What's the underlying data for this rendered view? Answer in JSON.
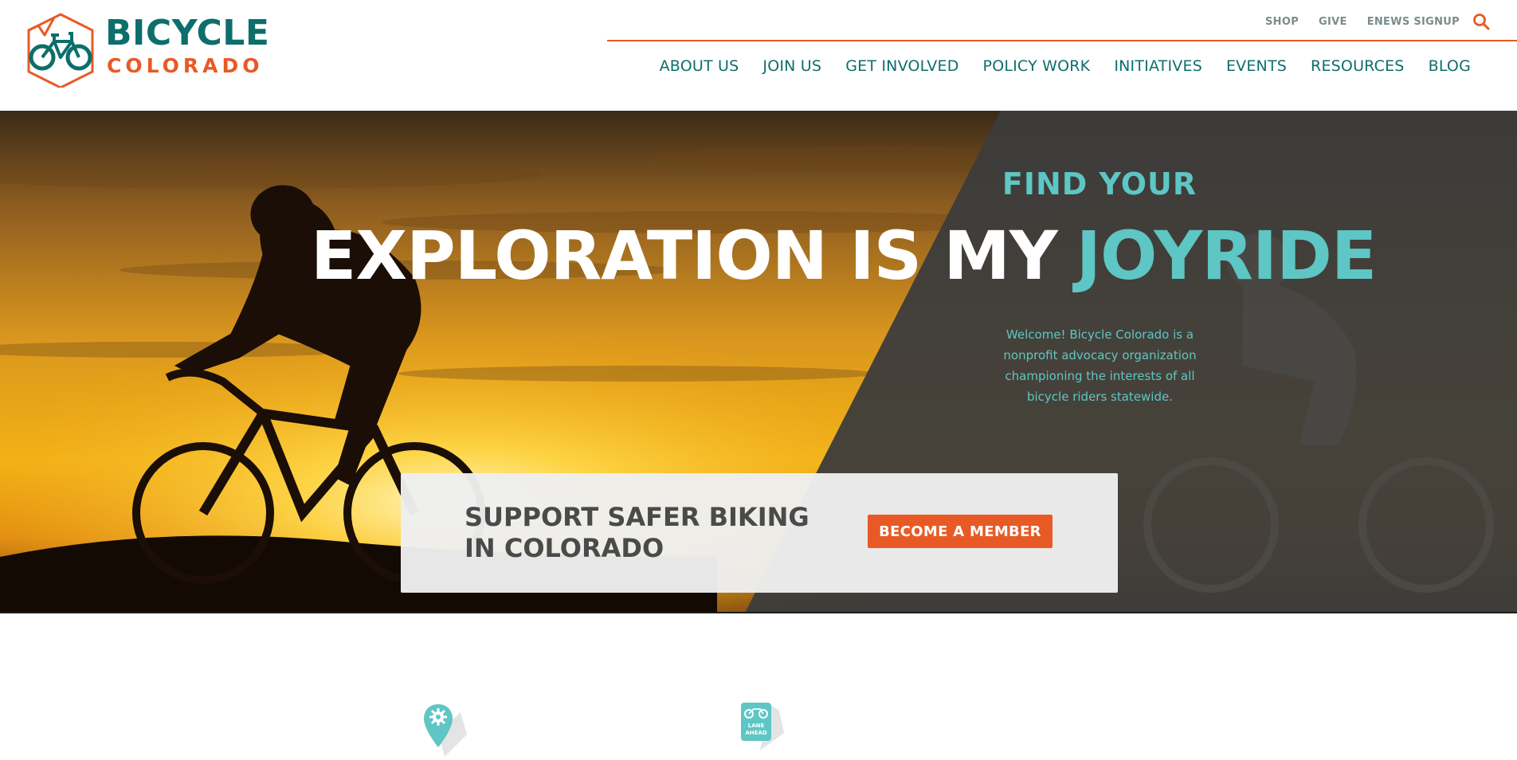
{
  "brand": {
    "name_line1": "BICYCLE",
    "name_line2": "COLORADO",
    "primary_color": "#0d6e6b",
    "accent_color": "#e85a25",
    "teal_color": "#5ec6c4"
  },
  "utility_nav": {
    "items": [
      {
        "label": "SHOP"
      },
      {
        "label": "GIVE"
      },
      {
        "label": "ENEWS SIGNUP"
      }
    ],
    "search_icon": "search-icon"
  },
  "main_nav": {
    "items": [
      {
        "label": "ABOUT US"
      },
      {
        "label": "JOIN US"
      },
      {
        "label": "GET INVOLVED"
      },
      {
        "label": "POLICY WORK"
      },
      {
        "label": "INITIATIVES"
      },
      {
        "label": "EVENTS"
      },
      {
        "label": "RESOURCES"
      },
      {
        "label": "BLOG"
      }
    ]
  },
  "hero": {
    "eyebrow": "FIND YOUR",
    "title_white": "EXPLORATION IS MY",
    "title_teal": "JOYRIDE",
    "welcome": "Welcome! Bicycle Colorado is a nonprofit advocacy organization championing the interests of all bicycle riders statewide."
  },
  "cta": {
    "text": "SUPPORT SAFER BIKING IN COLORADO",
    "button_label": "BECOME A MEMBER"
  },
  "features": {
    "icons": [
      "map-pin-gear-icon",
      "bike-lane-sign-icon"
    ],
    "lane_sign_text_1": "LANE",
    "lane_sign_text_2": "AHEAD"
  }
}
